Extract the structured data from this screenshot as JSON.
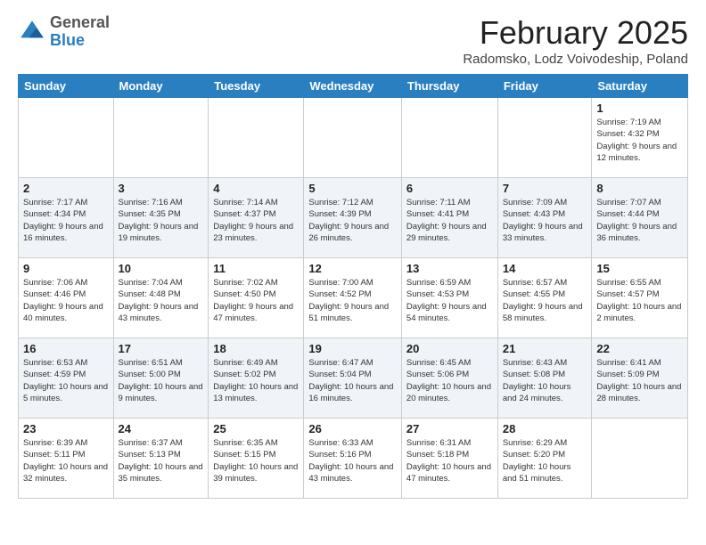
{
  "logo": {
    "general": "General",
    "blue": "Blue"
  },
  "header": {
    "title": "February 2025",
    "subtitle": "Radomsko, Lodz Voivodeship, Poland"
  },
  "weekdays": [
    "Sunday",
    "Monday",
    "Tuesday",
    "Wednesday",
    "Thursday",
    "Friday",
    "Saturday"
  ],
  "weeks": [
    [
      {
        "day": "",
        "info": ""
      },
      {
        "day": "",
        "info": ""
      },
      {
        "day": "",
        "info": ""
      },
      {
        "day": "",
        "info": ""
      },
      {
        "day": "",
        "info": ""
      },
      {
        "day": "",
        "info": ""
      },
      {
        "day": "1",
        "info": "Sunrise: 7:19 AM\nSunset: 4:32 PM\nDaylight: 9 hours and 12 minutes."
      }
    ],
    [
      {
        "day": "2",
        "info": "Sunrise: 7:17 AM\nSunset: 4:34 PM\nDaylight: 9 hours and 16 minutes."
      },
      {
        "day": "3",
        "info": "Sunrise: 7:16 AM\nSunset: 4:35 PM\nDaylight: 9 hours and 19 minutes."
      },
      {
        "day": "4",
        "info": "Sunrise: 7:14 AM\nSunset: 4:37 PM\nDaylight: 9 hours and 23 minutes."
      },
      {
        "day": "5",
        "info": "Sunrise: 7:12 AM\nSunset: 4:39 PM\nDaylight: 9 hours and 26 minutes."
      },
      {
        "day": "6",
        "info": "Sunrise: 7:11 AM\nSunset: 4:41 PM\nDaylight: 9 hours and 29 minutes."
      },
      {
        "day": "7",
        "info": "Sunrise: 7:09 AM\nSunset: 4:43 PM\nDaylight: 9 hours and 33 minutes."
      },
      {
        "day": "8",
        "info": "Sunrise: 7:07 AM\nSunset: 4:44 PM\nDaylight: 9 hours and 36 minutes."
      }
    ],
    [
      {
        "day": "9",
        "info": "Sunrise: 7:06 AM\nSunset: 4:46 PM\nDaylight: 9 hours and 40 minutes."
      },
      {
        "day": "10",
        "info": "Sunrise: 7:04 AM\nSunset: 4:48 PM\nDaylight: 9 hours and 43 minutes."
      },
      {
        "day": "11",
        "info": "Sunrise: 7:02 AM\nSunset: 4:50 PM\nDaylight: 9 hours and 47 minutes."
      },
      {
        "day": "12",
        "info": "Sunrise: 7:00 AM\nSunset: 4:52 PM\nDaylight: 9 hours and 51 minutes."
      },
      {
        "day": "13",
        "info": "Sunrise: 6:59 AM\nSunset: 4:53 PM\nDaylight: 9 hours and 54 minutes."
      },
      {
        "day": "14",
        "info": "Sunrise: 6:57 AM\nSunset: 4:55 PM\nDaylight: 9 hours and 58 minutes."
      },
      {
        "day": "15",
        "info": "Sunrise: 6:55 AM\nSunset: 4:57 PM\nDaylight: 10 hours and 2 minutes."
      }
    ],
    [
      {
        "day": "16",
        "info": "Sunrise: 6:53 AM\nSunset: 4:59 PM\nDaylight: 10 hours and 5 minutes."
      },
      {
        "day": "17",
        "info": "Sunrise: 6:51 AM\nSunset: 5:00 PM\nDaylight: 10 hours and 9 minutes."
      },
      {
        "day": "18",
        "info": "Sunrise: 6:49 AM\nSunset: 5:02 PM\nDaylight: 10 hours and 13 minutes."
      },
      {
        "day": "19",
        "info": "Sunrise: 6:47 AM\nSunset: 5:04 PM\nDaylight: 10 hours and 16 minutes."
      },
      {
        "day": "20",
        "info": "Sunrise: 6:45 AM\nSunset: 5:06 PM\nDaylight: 10 hours and 20 minutes."
      },
      {
        "day": "21",
        "info": "Sunrise: 6:43 AM\nSunset: 5:08 PM\nDaylight: 10 hours and 24 minutes."
      },
      {
        "day": "22",
        "info": "Sunrise: 6:41 AM\nSunset: 5:09 PM\nDaylight: 10 hours and 28 minutes."
      }
    ],
    [
      {
        "day": "23",
        "info": "Sunrise: 6:39 AM\nSunset: 5:11 PM\nDaylight: 10 hours and 32 minutes."
      },
      {
        "day": "24",
        "info": "Sunrise: 6:37 AM\nSunset: 5:13 PM\nDaylight: 10 hours and 35 minutes."
      },
      {
        "day": "25",
        "info": "Sunrise: 6:35 AM\nSunset: 5:15 PM\nDaylight: 10 hours and 39 minutes."
      },
      {
        "day": "26",
        "info": "Sunrise: 6:33 AM\nSunset: 5:16 PM\nDaylight: 10 hours and 43 minutes."
      },
      {
        "day": "27",
        "info": "Sunrise: 6:31 AM\nSunset: 5:18 PM\nDaylight: 10 hours and 47 minutes."
      },
      {
        "day": "28",
        "info": "Sunrise: 6:29 AM\nSunset: 5:20 PM\nDaylight: 10 hours and 51 minutes."
      },
      {
        "day": "",
        "info": ""
      }
    ]
  ]
}
